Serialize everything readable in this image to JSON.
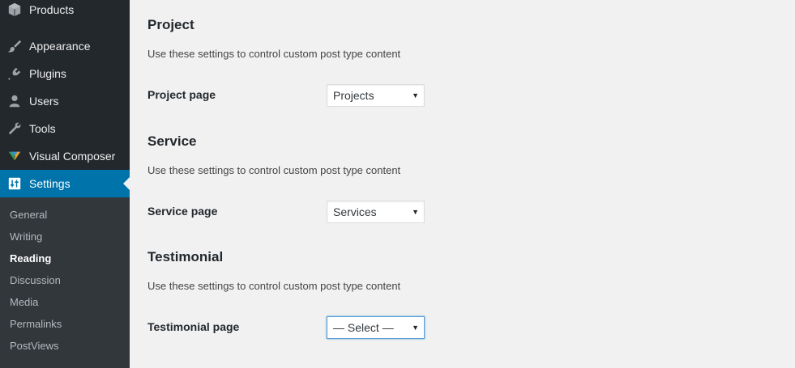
{
  "sidebar": {
    "menu": [
      {
        "label": "Products",
        "icon": "box-icon"
      },
      {
        "label": "Appearance",
        "icon": "paintbrush-icon"
      },
      {
        "label": "Plugins",
        "icon": "plug-icon"
      },
      {
        "label": "Users",
        "icon": "user-icon"
      },
      {
        "label": "Tools",
        "icon": "wrench-icon"
      },
      {
        "label": "Visual Composer",
        "icon": "visual-composer-icon"
      },
      {
        "label": "Settings",
        "icon": "settings-icon"
      }
    ],
    "submenu": [
      {
        "label": "General"
      },
      {
        "label": "Writing"
      },
      {
        "label": "Reading"
      },
      {
        "label": "Discussion"
      },
      {
        "label": "Media"
      },
      {
        "label": "Permalinks"
      },
      {
        "label": "PostViews"
      }
    ]
  },
  "sections": [
    {
      "title": "Project",
      "description": "Use these settings to control custom post type content",
      "field_label": "Project page",
      "selected": "Projects"
    },
    {
      "title": "Service",
      "description": "Use these settings to control custom post type content",
      "field_label": "Service page",
      "selected": "Services"
    },
    {
      "title": "Testimonial",
      "description": "Use these settings to control custom post type content",
      "field_label": "Testimonial page",
      "selected": "— Select —"
    }
  ],
  "colors": {
    "sidebar_bg": "#23282d",
    "submenu_bg": "#32373c",
    "active_bg": "#0073aa",
    "content_bg": "#f1f1f1"
  }
}
